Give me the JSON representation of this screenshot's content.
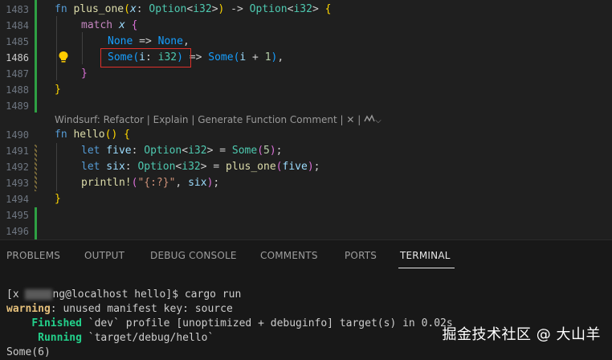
{
  "editor": {
    "line_numbers": [
      "1483",
      "1484",
      "1485",
      "1486",
      "1487",
      "1488",
      "1489",
      "1490",
      "1491",
      "1492",
      "1493",
      "1494",
      "1495",
      "1496"
    ],
    "active_line": "1486",
    "codelens": "Windsurf: Refactor | Explain | Generate Function Comment | ✕ |",
    "code": {
      "l1483": {
        "fn": "fn",
        "name": "plus_one",
        "p1": "(",
        "x": "x",
        "colon": ": ",
        "opt": "Option",
        "lt": "<",
        "i32": "i32",
        "gt": ">",
        "p2": ")",
        "arrow": " -> ",
        "opt2": "Option",
        "lt2": "<",
        "i32b": "i32",
        "gt2": ">",
        "brace": " {"
      },
      "l1484": {
        "match": "match",
        "x": " x",
        "brace": " {"
      },
      "l1485": {
        "none1": "None",
        "arrow": " => ",
        "none2": "None",
        "comma": ","
      },
      "l1486": {
        "some": "Some",
        "p1": "(",
        "i": "i",
        "colon": ": ",
        "i32": "i32",
        "p2": ")",
        "arrow": " => ",
        "some2": "Some",
        "p3": "(",
        "i2": "i",
        "plus": " + ",
        "one": "1",
        "p4": ")",
        "comma": ","
      },
      "l1487": {
        "brace": "}"
      },
      "l1488": {
        "brace": "}"
      },
      "l1490": {
        "fn": "fn",
        "name": "hello",
        "paren": "()",
        "brace": " {"
      },
      "l1491": {
        "let": "let",
        "var": " five",
        "colon": ": ",
        "opt": "Option",
        "lt": "<",
        "i32": "i32",
        "gt": ">",
        "eq": " = ",
        "some": "Some",
        "p1": "(",
        "num": "5",
        "p2": ")",
        "semi": ";"
      },
      "l1492": {
        "let": "let",
        "var": " six",
        "colon": ": ",
        "opt": "Option",
        "lt": "<",
        "i32": "i32",
        "gt": ">",
        "eq": " = ",
        "call": "plus_one",
        "p1": "(",
        "arg": "five",
        "p2": ")",
        "semi": ";"
      },
      "l1493": {
        "mac": "println!",
        "p1": "(",
        "str": "\"{:?}\"",
        "comma": ", ",
        "arg": "six",
        "p2": ")",
        "semi": ";"
      },
      "l1494": {
        "brace": "}"
      }
    }
  },
  "panel": {
    "tabs": [
      "PROBLEMS",
      "OUTPUT",
      "DEBUG CONSOLE",
      "COMMENTS",
      "PORTS",
      "TERMINAL"
    ],
    "active_tab": "TERMINAL"
  },
  "terminal": {
    "prompt_start": "[x ",
    "prompt_end": "ng@localhost hello]$ cargo run",
    "warning_label": "warning",
    "warning_text": ": unused manifest key: source",
    "finished_label": "Finished",
    "finished_text": " `dev` profile [unoptimized + debuginfo] target(s) in 0.02s",
    "running_label": "Running",
    "running_text": " `target/debug/hello`",
    "output": "Some(6)"
  },
  "watermark": "掘金技术社区 @ 大山羊",
  "colors": {
    "highlight_box": "#e0312b",
    "gutter_added": "#2ea043",
    "bulb": "#ffcc00"
  }
}
